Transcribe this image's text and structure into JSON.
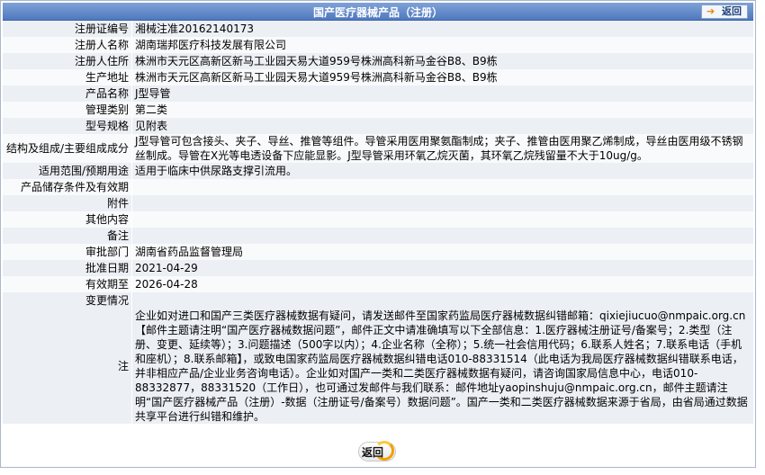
{
  "header": {
    "title": "国产医疗器械产品（注册）",
    "back_label": "返回"
  },
  "rows": [
    {
      "label": "注册证编号",
      "value": "湘械注准20162140173"
    },
    {
      "label": "注册人名称",
      "value": "湖南瑞邦医疗科技发展有限公司"
    },
    {
      "label": "注册人住所",
      "value": "株洲市天元区高新区新马工业园天易大道959号株洲高科新马金谷B8、B9栋"
    },
    {
      "label": "生产地址",
      "value": "株洲市天元区高新区新马工业园天易大道959号株洲高科新马金谷B8、B9栋"
    },
    {
      "label": "产品名称",
      "value": "J型导管"
    },
    {
      "label": "管理类别",
      "value": "第二类"
    },
    {
      "label": "型号规格",
      "value": "见附表"
    },
    {
      "label": "结构及组成/主要组成成分",
      "value": "J型导管可包含接头、夹子、导丝、推管等组件。导管采用医用聚氨酯制成；夹子、推管由医用聚乙烯制成，导丝由医用级不锈钢丝制成。导管在X光等电透设备下应能显影。J型导管采用环氧乙烷灭菌，其环氧乙烷残留量不大于10ug/g。"
    },
    {
      "label": "适用范围/预期用途",
      "value": "适用于临床中供尿路支撑引流用。"
    },
    {
      "label": "产品储存条件及有效期",
      "value": ""
    },
    {
      "label": "附件",
      "value": ""
    },
    {
      "label": "其他内容",
      "value": ""
    },
    {
      "label": "备注",
      "value": ""
    },
    {
      "label": "审批部门",
      "value": "湖南省药品监督管理局"
    },
    {
      "label": "批准日期",
      "value": "2021-04-29"
    },
    {
      "label": "有效期至",
      "value": "2026-04-28"
    },
    {
      "label": "变更情况",
      "value": ""
    }
  ],
  "note": {
    "label": "注",
    "text": "企业如对进口和国产三类医疗器械数据有疑问，请发送邮件至国家药监局医疗器械数据纠错邮箱：qixiejiucuo@nmpaic.org.cn【邮件主题请注明“国产医疗器械数据问题”，邮件正文中请准确填写以下全部信息：1.医疗器械注册证号/备案号；2.类型（注册、变更、延续等）；3.问题描述（500字以内）；4.企业名称（全称）；5.统一社会信用代码；6.联系人姓名；7.联系电话（手机和座机）；8.联系邮箱】，或致电国家药监局医疗器械数据纠错电话010-88331514（此电话为我局医疗器械数据纠错联系电话，并非相应产品/企业业务咨询电话）。企业如对国产一类和二类医疗器械数据有疑问，请咨询国家局信息中心，电话010-88332877，88331520（工作日），也可通过发邮件与我们联系：邮件地址yaopinshuju@nmpaic.org.cn，邮件主题请注明“国产医疗器械产品（注册）-数据（注册证号/备案号）数据问题”。国产一类和二类医疗器械数据来源于省局，由省局通过数据共享平台进行纠错和维护。"
  },
  "footer": {
    "back_label": "返回"
  },
  "colors": {
    "header_blue": "#5a82c4",
    "row_odd": "#eceff4",
    "row_even": "#f9fafb",
    "accent_orange": "#f0a000"
  },
  "icons": {
    "back_arrow": "arrow-right-icon"
  }
}
